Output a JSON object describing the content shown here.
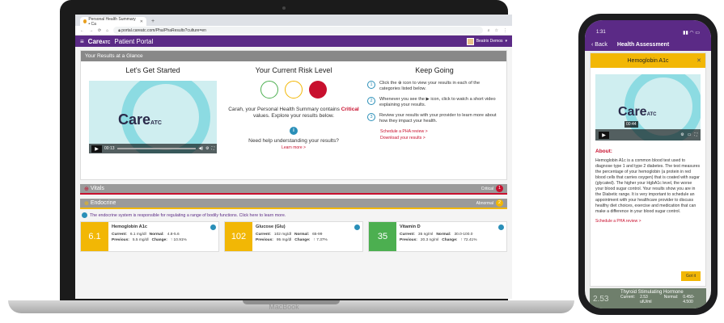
{
  "browser": {
    "tab_title": "Personal Health Summary • Ca",
    "url": "portal.careatc.com/Pha/PhaResults?culture=en"
  },
  "portal": {
    "logo": "Care",
    "logo_sub": "ATC",
    "title": "Patient Portal",
    "user_name": "Beatrix Demos"
  },
  "glance": {
    "header": "Your Results at a Glance",
    "col1_title": "Let's Get Started",
    "video_time": "00:13",
    "col2_title": "Your Current Risk Level",
    "risk_text_1": "Carah, your Personal Health Summary contains",
    "risk_critical": "Critical",
    "risk_text_2": "values. Explore your results below.",
    "help_text": "Need help understanding your results?",
    "learn_more": "Learn more >",
    "col3_title": "Keep Going",
    "steps": [
      {
        "n": "1",
        "text": "Click the ⊕ icon to view your results in each of the categories listed below."
      },
      {
        "n": "2",
        "text": "Whenever you see the ▶ icon, click to watch a short video explaining your results."
      },
      {
        "n": "3",
        "text": "Review your results with your provider to learn more about how they impact your health."
      }
    ],
    "schedule_link": "Schedule a PHA review >",
    "download_link": "Download your results >"
  },
  "vitals": {
    "label": "Vitals",
    "status": "Critical",
    "count": "1"
  },
  "endocrine": {
    "label": "Endocrine",
    "status": "Abnormal",
    "count": "2",
    "note": "The endocrine system is responsible for regulating a range of bodily functions. Click here to learn more.",
    "cards": [
      {
        "value": "6.1",
        "title": "Hemoglobin A1c",
        "current": "6.1 mg/dl",
        "normal": "4.8-5.6",
        "previous": "5.5 mg/dl",
        "change": "↑ 10.91%"
      },
      {
        "value": "102",
        "title": "Glucose (Glu)",
        "current": "102 mg/dl",
        "normal": "65-99",
        "previous": "95 mg/dl",
        "change": "↑ 7.37%"
      },
      {
        "value": "35",
        "title": "Vitamin D",
        "current": "35 ng/ml",
        "normal": "30.0-100.0",
        "previous": "20.3 ng/ml",
        "change": "↑ 72.41%"
      }
    ]
  },
  "labels": {
    "current": "Current:",
    "normal": "Normal:",
    "previous": "Previous:",
    "change": "Change:"
  },
  "laptop_brand": "MacBook",
  "phone": {
    "time": "1:31",
    "back": "Back",
    "nav_title": "Health Assessment",
    "modal_title": "Hemoglobin A1c",
    "video_time": "00:44",
    "about_title": "About:",
    "about_text": "Hemoglobin A1c is a common blood test used to diagnose type 1 and type 2 diabetes. The test measures the percentage of your hemoglobin (a protein in red blood cells that carries oxygen) that is coated with sugar (glycated). The higher your HgbA1c level, the worse your blood sugar control. Your results show you are in the Diabetic range. It is very important to schedule an appointment with your healthcare provider to discuss healthy diet choices, exercise and medication that can make a difference in your blood sugar control.",
    "schedule_link": "Schedule a PHA review >",
    "got_it": "Got it",
    "under_title": "Thyroid Stimulating Hormone",
    "under_value": "2.53",
    "under_current_label": "Current:",
    "under_current": "2.53 uIU/ml",
    "under_normal_label": "Normal:",
    "under_normal": "0.450-4.500"
  },
  "colors": {
    "purple": "#5b2a86",
    "critical": "#c8102e",
    "yellow": "#f2b705",
    "green": "#4caf50",
    "teal": "#2a8fb8"
  }
}
